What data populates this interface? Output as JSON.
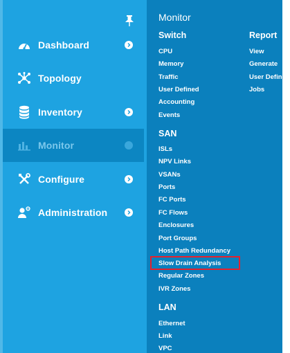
{
  "sidebar": {
    "items": [
      {
        "label": "Dashboard",
        "icon": "dashboard-icon",
        "has_chevron": true
      },
      {
        "label": "Topology",
        "icon": "topology-icon",
        "has_chevron": false
      },
      {
        "label": "Inventory",
        "icon": "database-icon",
        "has_chevron": true
      },
      {
        "label": "Monitor",
        "icon": "bar-chart-icon",
        "has_chevron": true,
        "active": true
      },
      {
        "label": "Configure",
        "icon": "tools-icon",
        "has_chevron": true
      },
      {
        "label": "Administration",
        "icon": "admin-user-icon",
        "has_chevron": true
      }
    ]
  },
  "submenu": {
    "title": "Monitor",
    "switch": {
      "heading": "Switch",
      "links": [
        "CPU",
        "Memory",
        "Traffic",
        "User Defined",
        "Accounting",
        "Events"
      ]
    },
    "report": {
      "heading": "Report",
      "links": [
        "View",
        "Generate",
        "User Defined",
        "Jobs"
      ]
    },
    "san": {
      "heading": "SAN",
      "links": [
        "ISLs",
        "NPV Links",
        "VSANs",
        "Ports",
        "FC Ports",
        "FC Flows",
        "Enclosures",
        "Port Groups",
        "Host Path Redundancy",
        "Slow Drain Analysis",
        "Regular Zones",
        "IVR Zones"
      ]
    },
    "lan": {
      "heading": "LAN",
      "links": [
        "Ethernet",
        "Link",
        "VPC"
      ]
    },
    "highlighted_item": "Slow Drain Analysis"
  },
  "colors": {
    "sidebar_bg": "#1ea3e1",
    "active_bg": "#0c86c2",
    "submenu_bg": "#0b80bd",
    "highlight_border": "#e8202a"
  }
}
